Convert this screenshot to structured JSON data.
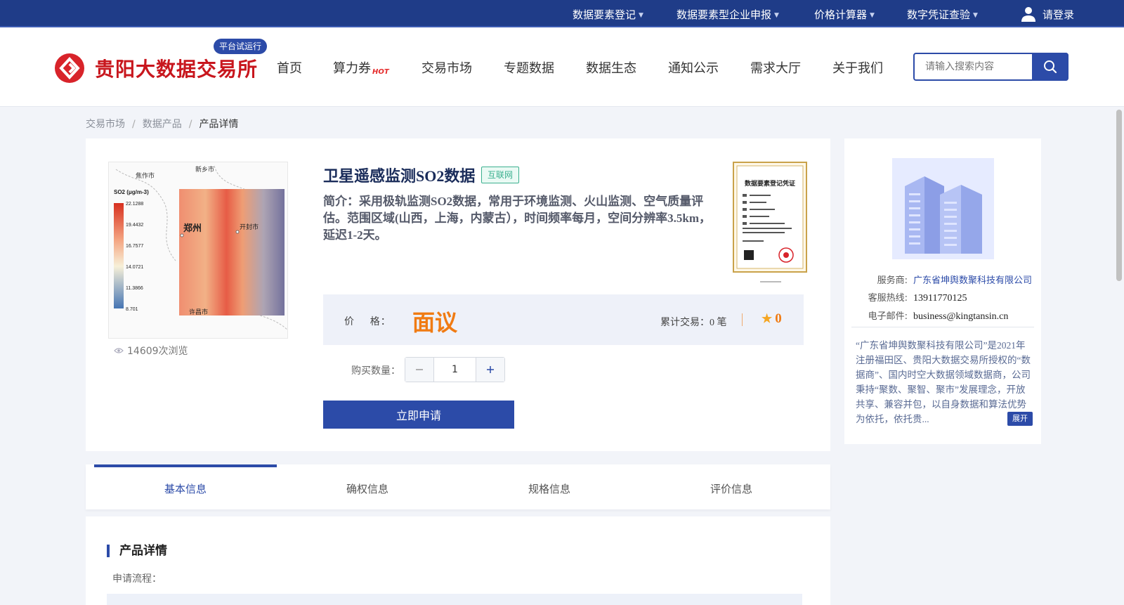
{
  "topbar": {
    "links": [
      "数据要素登记",
      "数据要素型企业申报",
      "价格计算器",
      "数字凭证查验"
    ],
    "login": "请登录",
    "colors": {
      "background": "#1f3c88"
    }
  },
  "header": {
    "logo_text": "贵阳大数据交易所",
    "trial_badge": "平台试运行",
    "nav": [
      "首页",
      "算力券",
      "交易市场",
      "专题数据",
      "数据生态",
      "通知公示",
      "需求大厅",
      "关于我们"
    ],
    "hot_label": "HOT",
    "search_placeholder": "请输入搜索内容",
    "colors": {
      "logo": "#c8161d",
      "accent": "#2c4ba8"
    }
  },
  "breadcrumb": [
    "交易市场",
    "数据产品",
    "产品详情"
  ],
  "product": {
    "title": "卫星遥感监测SO2数据",
    "tag": "互联网",
    "description": "简介：采用极轨监测SO2数据，常用于环境监测、火山监测、空气质量评估。范围区域(山西，上海，内蒙古），时间频率每月，空间分辨率3.5km，延迟1-2天。",
    "views": "14609次浏览",
    "price_label": "价    格：",
    "price_value": "面议",
    "trade_text": "累计交易：0 笔",
    "rating": "0",
    "qty_label": "购买数量：",
    "qty_value": "1",
    "apply_label": "立即申请",
    "map": {
      "legend_title": "SO2 (μg/m-3)",
      "legend_values": [
        "22.1288",
        "19.4432",
        "16.7577",
        "14.0721",
        "11.3866",
        "8.701"
      ],
      "cities": [
        "焦作市",
        "新乡市",
        "郑州",
        "开封市",
        "许昌市"
      ]
    },
    "cert_title": "数据要素登记凭证",
    "colors": {
      "price": "#f07b13",
      "tag": "#3bb08f"
    }
  },
  "provider": {
    "rows": [
      {
        "key": "服务商:",
        "value": "广东省坤舆数聚科技有限公司"
      },
      {
        "key": "客服热线:",
        "value": "13911770125"
      },
      {
        "key": "电子邮件:",
        "value": "business@kingtansin.cn"
      }
    ],
    "description": "“广东省坤舆数聚科技有限公司”是2021年注册福田区、贵阳大数据交易所授权的“数据商”、国内时空大数据领域数据商，公司秉持“聚数、聚智、聚市”发展理念，开放共享、兼容并包，以自身数据和算法优势为依托，依托贵...",
    "expand_label": "展开"
  },
  "tabs": [
    {
      "label": "基本信息",
      "active": true
    },
    {
      "label": "确权信息",
      "active": false
    },
    {
      "label": "规格信息",
      "active": false
    },
    {
      "label": "评价信息",
      "active": false
    }
  ],
  "details": {
    "title": "产品详情",
    "subtitle": "申请流程："
  }
}
